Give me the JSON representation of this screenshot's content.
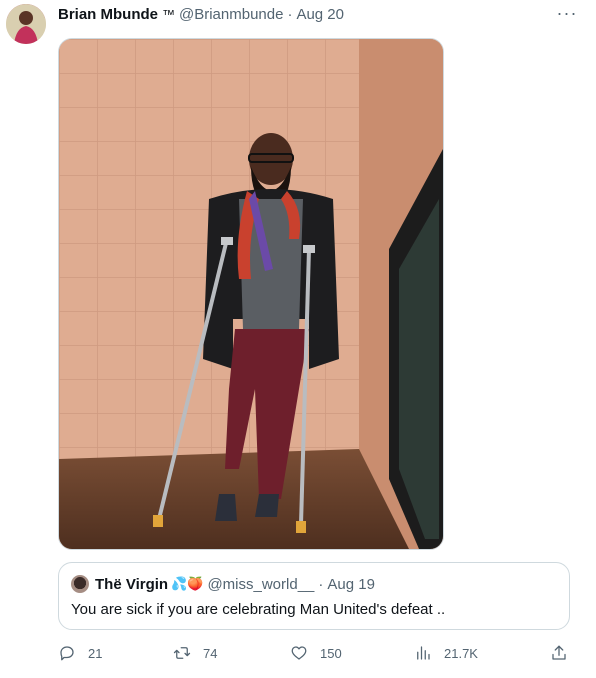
{
  "author": {
    "name": "Brian Mbunde",
    "badge": "™",
    "handle": "@Brianmbunde",
    "separator": "·",
    "date": "Aug 20"
  },
  "more_label": "···",
  "media": {
    "description_icon": "photo-of-man-with-crutches"
  },
  "quoted": {
    "name": "Thë Virgin",
    "emojis": "💦🍑",
    "handle": "@miss_world__",
    "separator": "·",
    "date": "Aug 19",
    "text": "You are sick if you are celebrating Man United's defeat .."
  },
  "actions": {
    "replies": "21",
    "retweets": "74",
    "likes": "150",
    "views": "21.7K"
  },
  "colors": {
    "text_secondary": "#536471",
    "border": "#cfd9de"
  }
}
